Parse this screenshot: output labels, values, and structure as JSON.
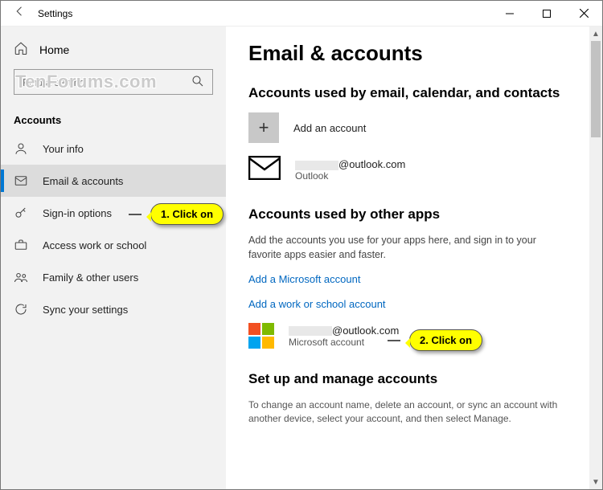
{
  "titlebar": {
    "title": "Settings"
  },
  "watermark": "TenForums.com",
  "sidebar": {
    "home": "Home",
    "search_placeholder": "Find a setting",
    "section": "Accounts",
    "items": [
      {
        "label": "Your info"
      },
      {
        "label": "Email & accounts"
      },
      {
        "label": "Sign-in options"
      },
      {
        "label": "Access work or school"
      },
      {
        "label": "Family & other users"
      },
      {
        "label": "Sync your settings"
      }
    ]
  },
  "main": {
    "page_title": "Email & accounts",
    "section1": {
      "heading": "Accounts used by email, calendar, and contacts",
      "add_label": "Add an account",
      "account1": {
        "email_suffix": "@outlook.com",
        "type": "Outlook"
      }
    },
    "section2": {
      "heading": "Accounts used by other apps",
      "desc": "Add the accounts you use for your apps here, and sign in to your favorite apps easier and faster.",
      "link_ms": "Add a Microsoft account",
      "link_work": "Add a work or school account",
      "account1": {
        "email_suffix": "@outlook.com",
        "type": "Microsoft account"
      }
    },
    "section3": {
      "heading": "Set up and manage accounts",
      "desc": "To change an account name, delete an account, or sync an account with another device, select your account, and then select Manage."
    }
  },
  "callouts": {
    "c1": "1. Click on",
    "c2": "2. Click on"
  }
}
